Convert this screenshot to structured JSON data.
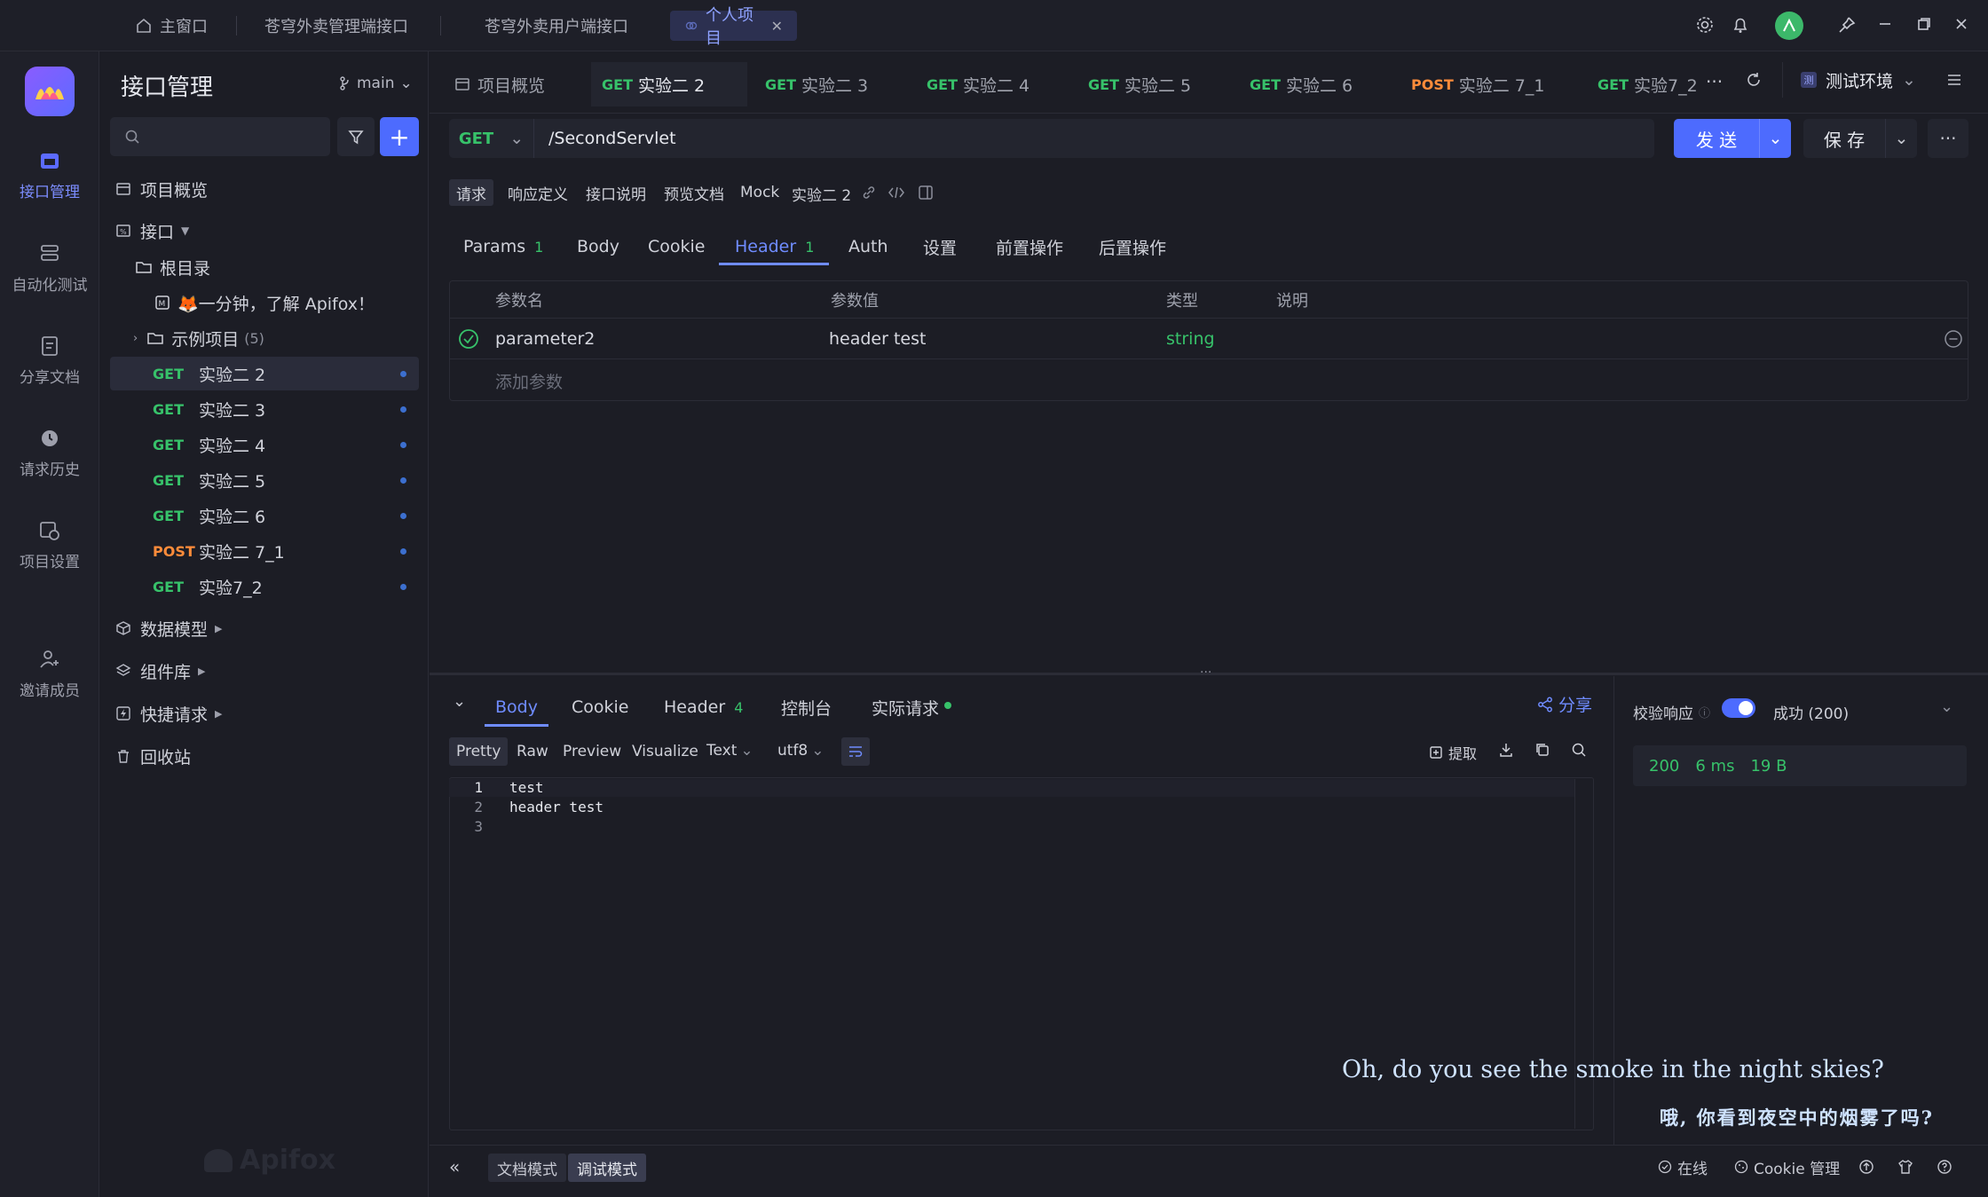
{
  "titlebar": {
    "tabs": [
      {
        "label": "主窗口",
        "icon": "home-icon"
      },
      {
        "label": "苍穹外卖管理端接口"
      },
      {
        "label": "苍穹外卖用户端接口"
      },
      {
        "label": "个人项目",
        "active": true
      }
    ]
  },
  "rail": {
    "items": [
      {
        "label": "接口管理",
        "icon": "api-icon",
        "active": true
      },
      {
        "label": "自动化测试",
        "icon": "stack-icon"
      },
      {
        "label": "分享文档",
        "icon": "doc-icon"
      },
      {
        "label": "请求历史",
        "icon": "history-icon"
      },
      {
        "label": "项目设置",
        "icon": "settings-icon"
      },
      {
        "label": "邀请成员",
        "icon": "invite-icon"
      }
    ]
  },
  "sidebar": {
    "title": "接口管理",
    "branch": "main",
    "search_placeholder": "",
    "items": {
      "overview": "项目概览",
      "interfaces": "接口",
      "root": "根目录",
      "intro": "🦊一分钟，了解 Apifox！",
      "examples": "示例项目",
      "examples_count": "(5)",
      "data_model": "数据模型",
      "components": "组件库",
      "quick_request": "快捷请求",
      "trash": "回收站"
    },
    "endpoints": [
      {
        "method": "GET",
        "name": "实验二 2",
        "selected": true
      },
      {
        "method": "GET",
        "name": "实验二 3"
      },
      {
        "method": "GET",
        "name": "实验二 4"
      },
      {
        "method": "GET",
        "name": "实验二 5"
      },
      {
        "method": "GET",
        "name": "实验二 6"
      },
      {
        "method": "POST",
        "name": "实验二 7_1"
      },
      {
        "method": "GET",
        "name": "实验7_2"
      }
    ],
    "watermark": "Apifox"
  },
  "tabs": {
    "overview": "项目概览",
    "items": [
      {
        "method": "GET",
        "name": "实验二 2",
        "active": true
      },
      {
        "method": "GET",
        "name": "实验二 3"
      },
      {
        "method": "GET",
        "name": "实验二 4"
      },
      {
        "method": "GET",
        "name": "实验二 5"
      },
      {
        "method": "GET",
        "name": "实验二 6"
      },
      {
        "method": "POST",
        "name": "实验二 7_1"
      },
      {
        "method": "GET",
        "name": "实验7_2"
      }
    ],
    "more": "···",
    "environment": "测试环境"
  },
  "request": {
    "method": "GET",
    "url": "/SecondServlet",
    "send": "发 送",
    "save": "保 存"
  },
  "mini_tabs": [
    "请求",
    "响应定义",
    "接口说明",
    "预览文档",
    "Mock"
  ],
  "endpoint_name": "实验二 2",
  "param_tabs": [
    {
      "label": "Params",
      "count": "1"
    },
    {
      "label": "Body"
    },
    {
      "label": "Cookie"
    },
    {
      "label": "Header",
      "count": "1",
      "active": true
    },
    {
      "label": "Auth"
    },
    {
      "label": "设置"
    },
    {
      "label": "前置操作"
    },
    {
      "label": "后置操作"
    }
  ],
  "header_table": {
    "columns": [
      "参数名",
      "参数值",
      "类型",
      "说明"
    ],
    "rows": [
      {
        "name": "parameter2",
        "value": "header test",
        "type": "string",
        "desc": ""
      }
    ],
    "add_placeholder": "添加参数"
  },
  "response": {
    "tabs": [
      {
        "label": "Body",
        "active": true
      },
      {
        "label": "Cookie"
      },
      {
        "label": "Header",
        "count": "4"
      },
      {
        "label": "控制台"
      },
      {
        "label": "实际请求"
      }
    ],
    "share": "分享",
    "formats": [
      "Pretty",
      "Raw",
      "Preview",
      "Visualize"
    ],
    "text_select": "Text",
    "encoding_select": "utf8",
    "extract": "提取",
    "lines": [
      "test",
      "header test",
      ""
    ],
    "validate_label": "校验响应",
    "success_label": "成功 (200)",
    "status": "200",
    "time": "6 ms",
    "size": "19 B"
  },
  "subtitles": {
    "en": "Oh, do you see the smoke in the night skies?",
    "zh": "哦, 你看到夜空中的烟雾了吗?"
  },
  "footer": {
    "doc_mode": "文档模式",
    "debug_mode": "调试模式",
    "online": "在线",
    "cookie": "Cookie 管理"
  },
  "colors": {
    "accent": "#6f8cff",
    "get": "#37c26a",
    "post": "#ff8c3a",
    "send_button": "#4d6bfe"
  }
}
